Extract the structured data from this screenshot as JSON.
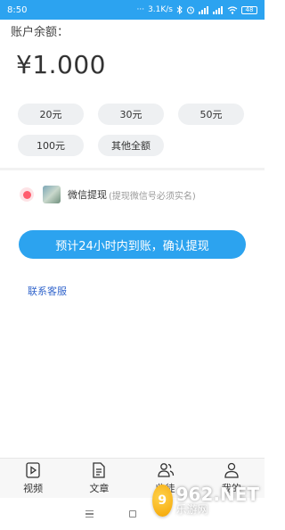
{
  "status_bar": {
    "time": "8:50",
    "network_speed": "3.1K/s",
    "battery": "48",
    "icons": [
      "dots-icon",
      "bluetooth-icon",
      "alarm-icon",
      "signal-icon",
      "signal-icon",
      "wifi-icon",
      "battery-icon"
    ]
  },
  "balance": {
    "label": "账户余额：",
    "amount": "¥1.000"
  },
  "amount_options": [
    {
      "label": "20元"
    },
    {
      "label": "30元"
    },
    {
      "label": "50元"
    },
    {
      "label": "100元"
    },
    {
      "label": "其他全额"
    }
  ],
  "withdraw_method": {
    "title": "微信提现",
    "note": "(提现微信号必须实名)",
    "selected": true
  },
  "confirm_button": {
    "label": "预计24小时内到账，确认提现"
  },
  "service_link": "联系客服",
  "bottom_nav": [
    {
      "label": "视频",
      "icon": "video-icon"
    },
    {
      "label": "文章",
      "icon": "article-icon"
    },
    {
      "label": "收徒",
      "icon": "users-icon"
    },
    {
      "label": "我的",
      "icon": "person-icon"
    }
  ],
  "watermark": {
    "brand": "962.NET",
    "sub": "乐游网"
  },
  "colors": {
    "accent": "#2ca3ef",
    "status_bar": "#2ca3f0",
    "chip_bg": "#eef0f2",
    "link": "#3366cc",
    "radio": "#ff5d6e"
  }
}
